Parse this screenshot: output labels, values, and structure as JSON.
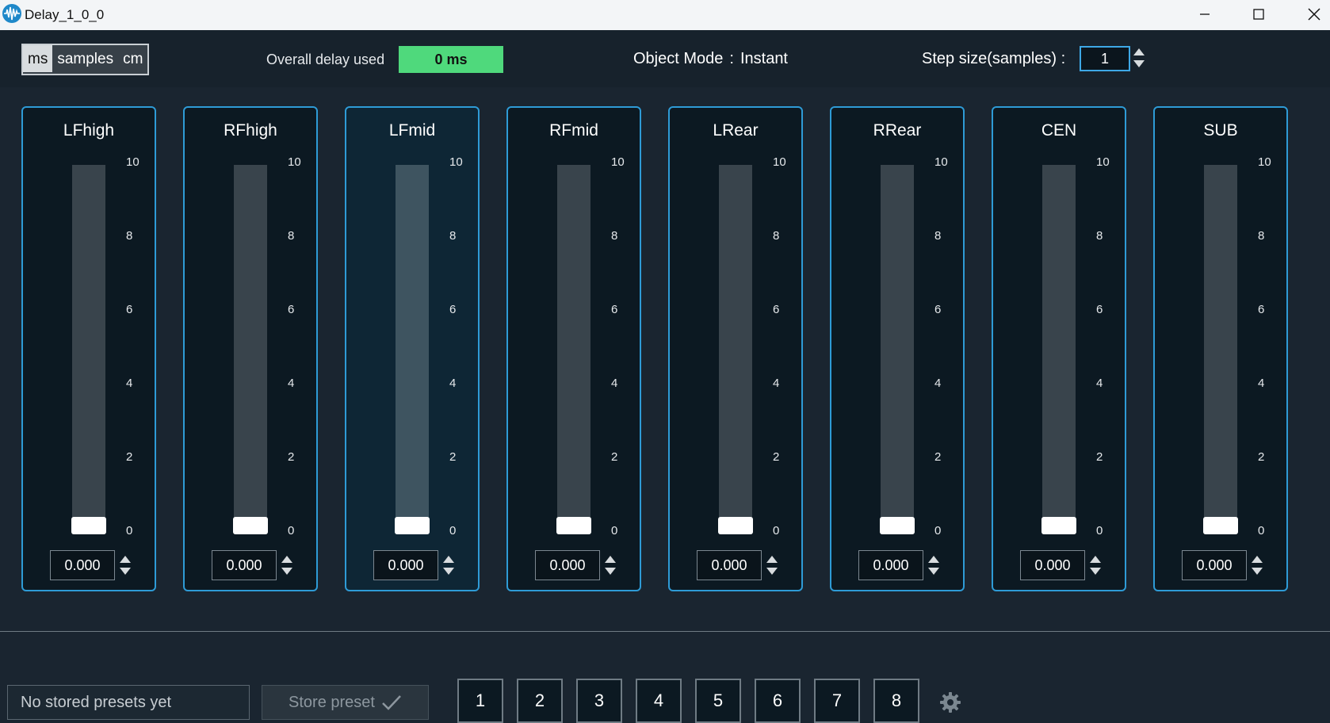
{
  "window": {
    "title": "Delay_1_0_0",
    "app_icon": "waveform-icon",
    "controls": [
      "minimize-icon",
      "maximize-icon",
      "close-icon"
    ]
  },
  "toolbar": {
    "units": [
      {
        "label": "ms",
        "active": true
      },
      {
        "label": "samples",
        "active": false
      },
      {
        "label": "cm",
        "active": false
      }
    ],
    "overall_delay_label": "Overall delay used",
    "overall_delay_value": "0 ms",
    "overall_delay_color": "#4fd97c",
    "object_mode_label": "Object Mode",
    "object_mode_sep": ":",
    "object_mode_value": "Instant",
    "step_label": "Step size(samples) :",
    "step_value": "1"
  },
  "channels": [
    {
      "name": "LFhigh",
      "value": "0.000",
      "slider_level": 0
    },
    {
      "name": "RFhigh",
      "value": "0.000",
      "slider_level": 0
    },
    {
      "name": "LFmid",
      "value": "0.000",
      "slider_level": 0,
      "selected": true
    },
    {
      "name": "RFmid",
      "value": "0.000",
      "slider_level": 0
    },
    {
      "name": "LRear",
      "value": "0.000",
      "slider_level": 0
    },
    {
      "name": "RRear",
      "value": "0.000",
      "slider_level": 0
    },
    {
      "name": "CEN",
      "value": "0.000",
      "slider_level": 0
    },
    {
      "name": "SUB",
      "value": "0.000",
      "slider_level": 0
    }
  ],
  "scale_ticks": [
    "10",
    "8",
    "6",
    "4",
    "2",
    "0"
  ],
  "scale_range": [
    0,
    10
  ],
  "presets": {
    "placeholder": "No stored presets yet",
    "store_label": "Store preset",
    "store_icon": "checkmark-icon",
    "slots": [
      "1",
      "2",
      "3",
      "4",
      "5",
      "6",
      "7",
      "8"
    ],
    "settings_icon": "gear-icon"
  },
  "colors": {
    "accent": "#2e9bd6",
    "background": "#1a2530"
  }
}
